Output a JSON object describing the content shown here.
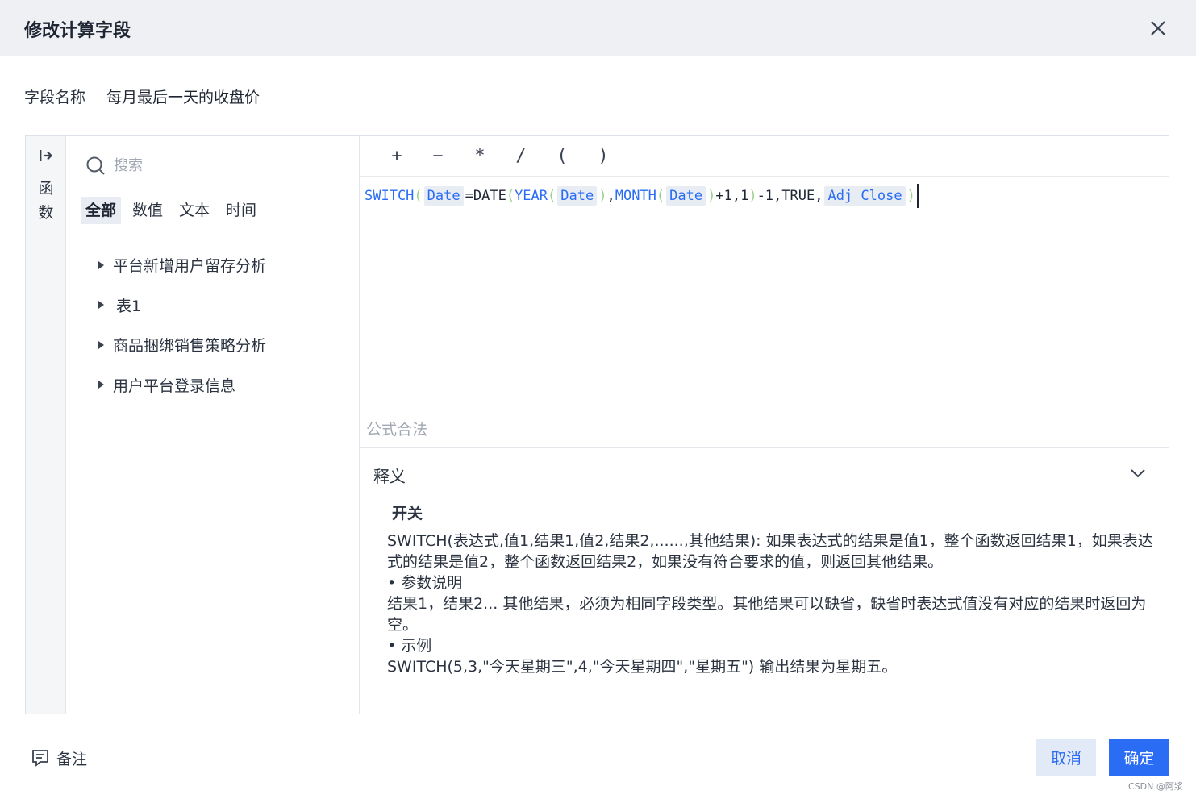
{
  "dialog": {
    "title": "修改计算字段",
    "close_icon": "close-icon"
  },
  "field_name": {
    "label": "字段名称",
    "value": "每月最后一天的收盘价"
  },
  "rail": {
    "label": "函数",
    "icon": "expand-icon"
  },
  "search": {
    "placeholder": "搜索",
    "icon": "search-icon"
  },
  "tabs": [
    {
      "label": "全部",
      "active": true
    },
    {
      "label": "数值",
      "active": false
    },
    {
      "label": "文本",
      "active": false
    },
    {
      "label": "时间",
      "active": false
    }
  ],
  "tree": [
    {
      "label": "平台新增用户留存分析"
    },
    {
      "label": "表1"
    },
    {
      "label": "商品捆绑销售策略分析"
    },
    {
      "label": "用户平台登录信息"
    }
  ],
  "operators": [
    "+",
    "−",
    "*",
    "/",
    "(",
    ")"
  ],
  "formula": {
    "tokens": [
      {
        "t": "SWITCH",
        "c": "fn"
      },
      {
        "t": "(",
        "c": "par"
      },
      {
        "t": "Date",
        "c": "fld"
      },
      {
        "t": "=DATE",
        "c": "plain"
      },
      {
        "t": "(",
        "c": "par"
      },
      {
        "t": "YEAR",
        "c": "fn"
      },
      {
        "t": "(",
        "c": "par"
      },
      {
        "t": "Date",
        "c": "fld"
      },
      {
        "t": ")",
        "c": "par"
      },
      {
        "t": ",",
        "c": "plain"
      },
      {
        "t": "MONTH",
        "c": "fn"
      },
      {
        "t": "(",
        "c": "par"
      },
      {
        "t": "Date",
        "c": "fld"
      },
      {
        "t": ")",
        "c": "par"
      },
      {
        "t": "+1,1",
        "c": "plain"
      },
      {
        "t": ")",
        "c": "par"
      },
      {
        "t": "-1,TRUE,",
        "c": "plain"
      },
      {
        "t": "Adj Close",
        "c": "fld"
      },
      {
        "t": ")",
        "c": "par"
      }
    ]
  },
  "validation": "公式合法",
  "explanation": {
    "title": "释义",
    "function_name": "开关",
    "syntax": "SWITCH(表达式,值1,结果1,值2,结果2,......,其他结果): 如果表达式的结果是值1，整个函数返回结果1，如果表达式的结果是值2，整个函数返回结果2，如果没有符合要求的值，则返回其他结果。",
    "params_heading": "• 参数说明",
    "params_text": "结果1，结果2... 其他结果，必须为相同字段类型。其他结果可以缺省，缺省时表达式值没有对应的结果时返回为空。",
    "example_heading": "• 示例",
    "example_text": "SWITCH(5,3,\"今天星期三\",4,\"今天星期四\",\"星期五\") 输出结果为星期五。"
  },
  "footer": {
    "note_label": "备注",
    "cancel_label": "取消",
    "ok_label": "确定"
  },
  "watermark": "CSDN @阿浆",
  "colors": {
    "accent": "#2a6df4",
    "header_bg": "#eef0f3",
    "paren": "#9ad08e"
  }
}
